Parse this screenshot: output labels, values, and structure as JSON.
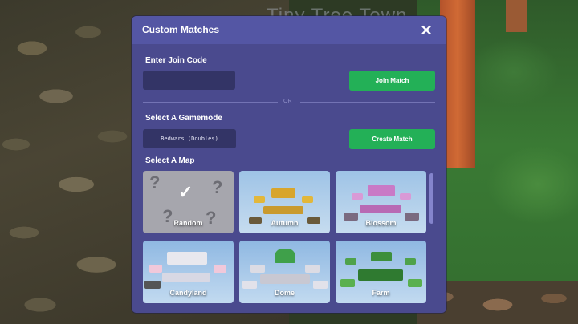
{
  "background": {
    "title_fragment": "Tiny Tree Town"
  },
  "panel": {
    "title": "Custom Matches",
    "close_icon": "close-icon",
    "join": {
      "label": "Enter Join Code",
      "input_value": "",
      "input_placeholder": "",
      "button": "Join Match"
    },
    "or_text": "OR",
    "gamemode": {
      "label": "Select A Gamemode",
      "selected": "Bedwars (Doubles)",
      "button": "Create Match"
    },
    "maps": {
      "label": "Select A Map",
      "items": [
        {
          "name": "Random",
          "selected": true
        },
        {
          "name": "Autumn",
          "selected": false
        },
        {
          "name": "Blossom",
          "selected": false
        },
        {
          "name": "Candyland",
          "selected": false
        },
        {
          "name": "Dome",
          "selected": false
        },
        {
          "name": "Farm",
          "selected": false
        }
      ]
    }
  },
  "colors": {
    "panel_bg": "#4a4a8e",
    "header_bg": "#5456a4",
    "input_bg": "#333466",
    "button_green": "#23b057"
  }
}
